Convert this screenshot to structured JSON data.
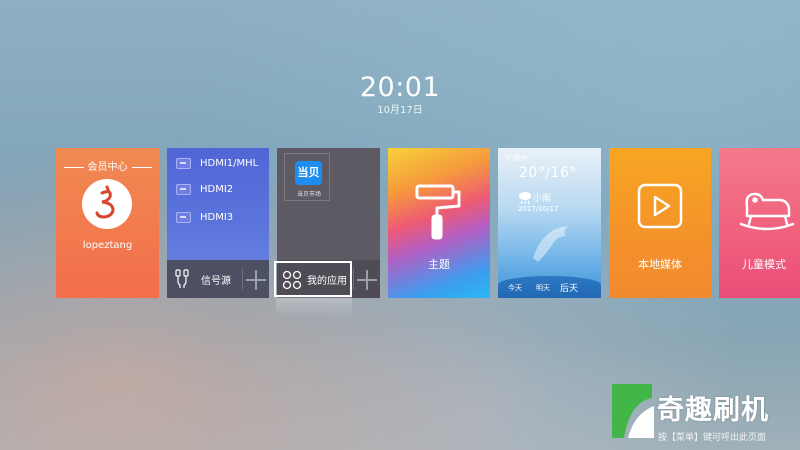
{
  "clock": {
    "time": "20:01",
    "date": "10月17日"
  },
  "tiles": {
    "member": {
      "title": "会员中心",
      "username": "lopeztang"
    },
    "source": {
      "items": [
        "HDMI1/MHL",
        "HDMI2",
        "HDMI3"
      ],
      "label": "信号源"
    },
    "apps": {
      "app_name": "当贝",
      "app_caption": "当贝市场",
      "label": "我的应用"
    },
    "theme": {
      "label": "主题"
    },
    "weather": {
      "city": "杭州",
      "temperature": "20°/16°",
      "condition": "小雨",
      "date": "2017/10/17",
      "days": [
        "今天",
        "明天",
        "后天"
      ]
    },
    "media": {
      "label": "本地媒体"
    },
    "kids": {
      "label": "儿童模式"
    }
  },
  "watermark": {
    "brand": "奇趣刷机",
    "hint": "按【菜单】键可呼出此页面"
  },
  "colors": {
    "member": "#f36e4b",
    "source": "#5166d6",
    "apps": "#5d5a64",
    "media": "#f4922a",
    "kids": "#f05f7d",
    "brand_green": "#43b649"
  }
}
